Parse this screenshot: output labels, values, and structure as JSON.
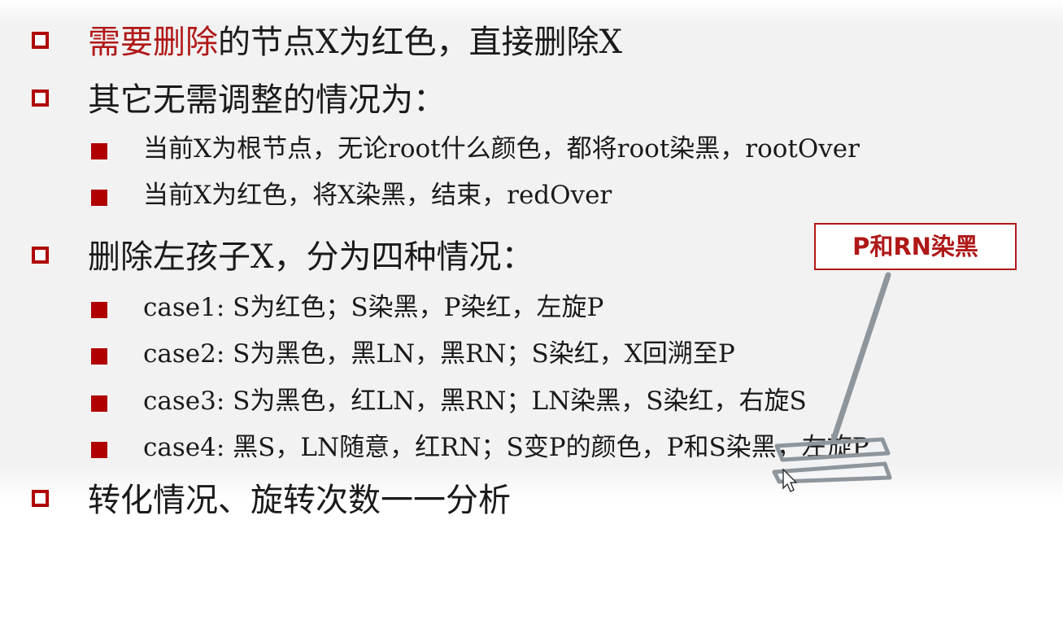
{
  "bullets": [
    {
      "highlight": "需要删除",
      "text": "的节点X为红色，直接删除X"
    },
    {
      "text": "其它无需调整的情况为："
    },
    {
      "text": "当前X为根节点，无论root什么颜色，都将root染黑，rootOver"
    },
    {
      "text": "当前X为红色，将X染黑，结束，redOver"
    },
    {
      "text": "删除左孩子X，分为四种情况："
    },
    {
      "text": "case1: S为红色；S染黑，P染红，左旋P"
    },
    {
      "text": "case2: S为黑色，黑LN，黑RN；S染红，X回溯至P"
    },
    {
      "text": "case3: S为黑色，红LN，黑RN；LN染黑，S染红，右旋S"
    },
    {
      "text": "case4: 黑S，LN随意，红RN；S变P的颜色，P和S染黑，左旋P"
    },
    {
      "text": "转化情况、旋转次数一一分析"
    }
  ],
  "callout": {
    "text": "P和RN染黑"
  },
  "colors": {
    "accent_red": "#b01818",
    "bullet_red": "#b00000",
    "annotation_gray": "#8e969d"
  }
}
